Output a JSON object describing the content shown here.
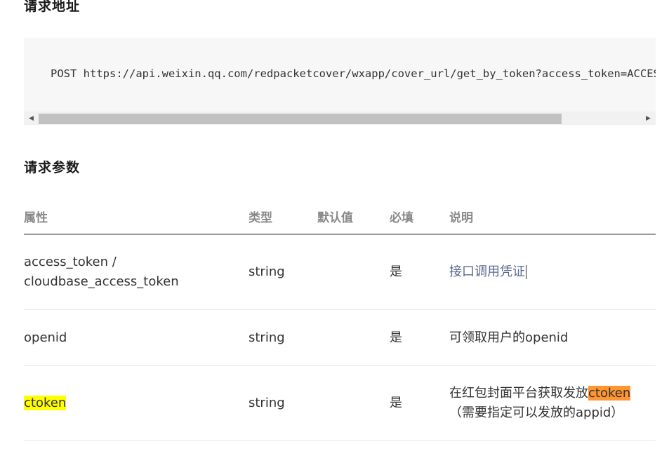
{
  "section_address": {
    "title": "请求地址"
  },
  "code": {
    "text": "POST https://api.weixin.qq.com/redpacketcover/wxapp/cover_url/get_by_token?access_token=ACCESS_TOKEN"
  },
  "section_params": {
    "title": "请求参数"
  },
  "table": {
    "headers": [
      "属性",
      "类型",
      "默认值",
      "必填",
      "说明"
    ],
    "rows": [
      {
        "name": "access_token / cloudbase_access_token",
        "type": "string",
        "default": "",
        "required": "是",
        "desc": "接口调用凭证"
      },
      {
        "name": "openid",
        "type": "string",
        "default": "",
        "required": "是",
        "desc": "可领取用户的openid"
      },
      {
        "name": "ctoken",
        "type": "string",
        "default": "",
        "required": "是",
        "desc_prefix": "在红包封面平台获取发放",
        "desc_highlight": "ctoken",
        "desc_suffix": "（需要指定可以发放的appid）"
      }
    ]
  },
  "colors": {
    "highlight_yellow": "#ffff00",
    "highlight_orange": "#ff9632",
    "code_bg": "#f7f7f7"
  }
}
